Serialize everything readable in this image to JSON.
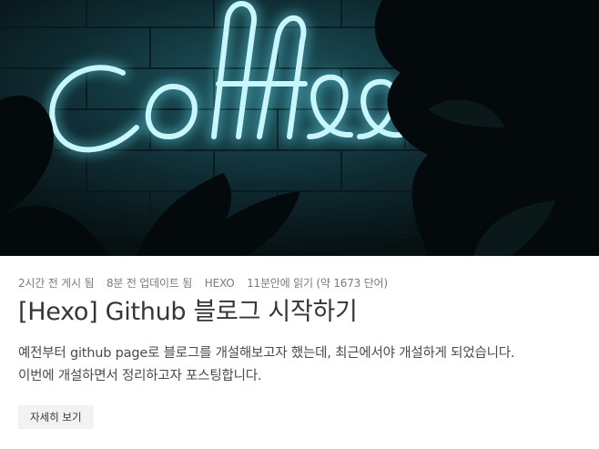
{
  "post": {
    "cover_alt": "coffee",
    "meta": {
      "posted": "2시간 전 게시 됨",
      "updated": "8분 전 업데이트 됨",
      "category": "HEXO",
      "reading": "11분안에 읽기 (약 1673 단어)"
    },
    "title": "[Hexo] Github 블로그 시작하기",
    "excerpt": {
      "line1": "예전부터 github page로 블로그를 개설해보고자 했는데, 최근에서야 개설하게 되었습니다.",
      "line2": "이번에 개설하면서 정리하고자 포스팅합니다."
    },
    "read_more_label": "자세히 보기"
  },
  "colors": {
    "neon": "#8fe9f2",
    "wall": "#0b1518",
    "title": "#363636",
    "meta": "#7a7a7a"
  }
}
